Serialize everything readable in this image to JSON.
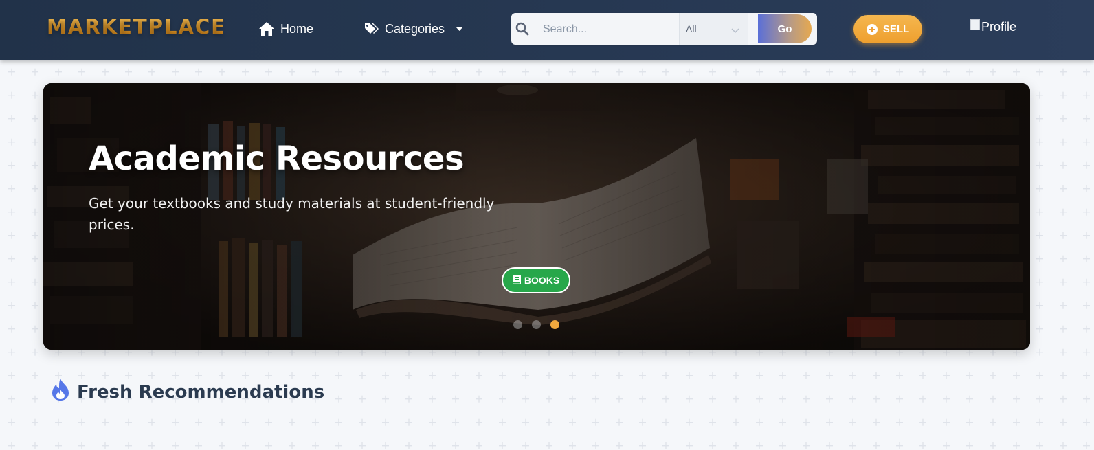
{
  "header": {
    "logo": "MARKETPLACE",
    "nav": [
      {
        "label": "Home",
        "icon": "home-icon"
      },
      {
        "label": "Categories",
        "icon": "tags-icon"
      }
    ],
    "search": {
      "placeholder": "Search...",
      "value": "",
      "category_selected": "All",
      "go_label": "Go"
    },
    "sell_label": "SELL",
    "profile_alt": "Profile"
  },
  "hero": {
    "title": "Academic Resources",
    "subtitle": "Get your textbooks and study materials at student-friendly prices.",
    "badge_label": "BOOKS",
    "badge_icon": "book-icon",
    "slides": 3,
    "active_slide": 3
  },
  "section": {
    "title": "Fresh Recommendations",
    "icon": "fire-icon"
  },
  "colors": {
    "header_bg": "#233550",
    "accent_orange": "#f0a23a",
    "badge_green": "#27a74a",
    "section_icon_blue": "#5677e8",
    "page_bg": "#f5f7fa"
  }
}
